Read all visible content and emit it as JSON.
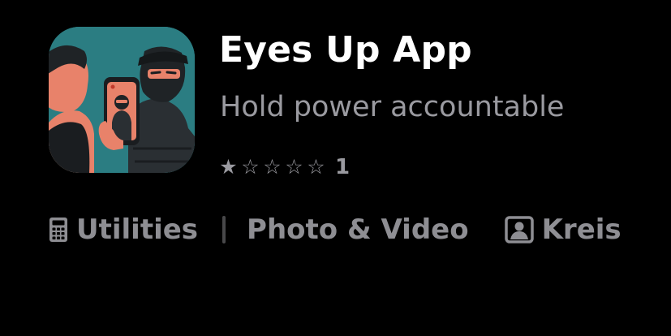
{
  "app": {
    "title": "Eyes Up App",
    "subtitle": "Hold power accountable"
  },
  "rating": {
    "value": 1,
    "max": 5,
    "count": "1"
  },
  "meta": {
    "category": "Utilities",
    "genre": "Photo & Video",
    "developer": "Kreis"
  },
  "icons": {
    "app_icon": "app-icon-person-filming-masked-officer",
    "category_icon": "calculator-icon",
    "developer_icon": "person-square-icon"
  },
  "colors": {
    "background": "#000000",
    "title": "#ffffff",
    "secondary_text": "#9a9aa0",
    "icon_teal": "#2b7d82",
    "icon_orange": "#e8826a"
  }
}
